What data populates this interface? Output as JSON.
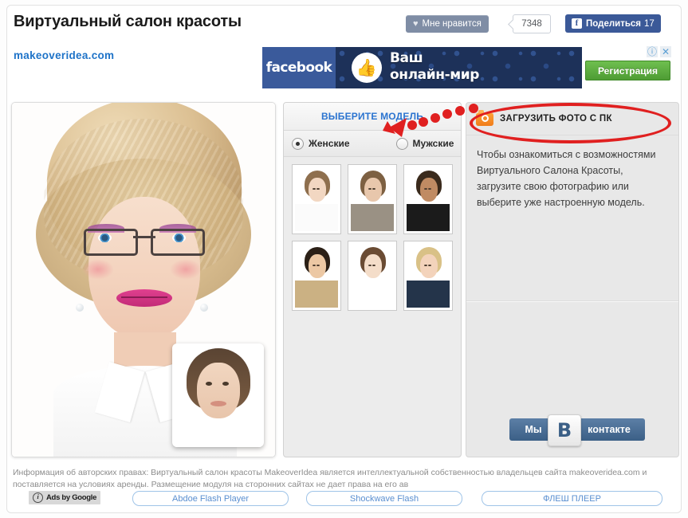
{
  "header": {
    "site_title": "Виртуальный салон красоты",
    "like_label": "Мне нравится",
    "like_count": "7348",
    "share_label": "Поделиться",
    "share_count": "17",
    "heart_icon": "♥",
    "fb_icon": "f"
  },
  "site_url": "makeoveridea.com",
  "banner": {
    "brand": "facebook",
    "headline_line1": "Ваш",
    "headline_line2": "онлайн-мир",
    "thumb_icon": "👍",
    "register_label": "Регистрация",
    "info_icon": "ⓘ",
    "close_icon": "✕"
  },
  "models": {
    "heading": "ВЫБЕРИТЕ МОДЕЛЬ",
    "gender_options": [
      {
        "label": "Женские",
        "selected": true
      },
      {
        "label": "Мужские",
        "selected": false
      }
    ],
    "thumbnails": [
      {
        "name": "model-1",
        "hair": "#8e6f4e",
        "skin": "#f2d7c2",
        "body": "#fbfbfb"
      },
      {
        "name": "model-2",
        "hair": "#7d6042",
        "skin": "#e8c7ac",
        "body": "#9a9184"
      },
      {
        "name": "model-3",
        "hair": "#3a2a1c",
        "skin": "#c08b63",
        "body": "#1b1b1b"
      },
      {
        "name": "model-4",
        "hair": "#2b2017",
        "skin": "#ecc8a4",
        "body": "#cbb183"
      },
      {
        "name": "model-5",
        "hair": "#6a4b33",
        "skin": "#f4ddc9",
        "body": "#ffffff"
      },
      {
        "name": "model-6",
        "hair": "#d9c187",
        "skin": "#f3d3bb",
        "body": "#24344a"
      }
    ]
  },
  "info": {
    "upload_label": "ЗАГРУЗИТЬ ФОТО С ПК",
    "camera_icon": "camera-icon",
    "description": "Чтобы ознакомиться с возможностями Виртуального Салона Красоты, загрузите свою фотографию или выберите уже настроенную модель.",
    "vk_left": "Мы",
    "vk_logo": "В",
    "vk_right": "контакте"
  },
  "footer": {
    "copyright": "Информация об авторских правах: Виртуальный салон красоты MakeoverIdea является интеллектуальной собственностью владельцев сайта makeoveridea.com и поставляется на условиях аренды. Размещение модуля на сторонних сайтах не дает права на его ав",
    "ads_label": "Ads by Google",
    "ads_info_icon": "i",
    "ad_links": [
      "Abdoe Flash Player",
      "Shockwave Flash",
      "ФЛЕШ ПЛЕЕР"
    ]
  },
  "colors": {
    "accent_blue": "#2b74d0",
    "fb_blue": "#3b5998",
    "annotation_red": "#e02020",
    "green_button": "#4e9c34",
    "orange_icon": "#f07c1b"
  }
}
